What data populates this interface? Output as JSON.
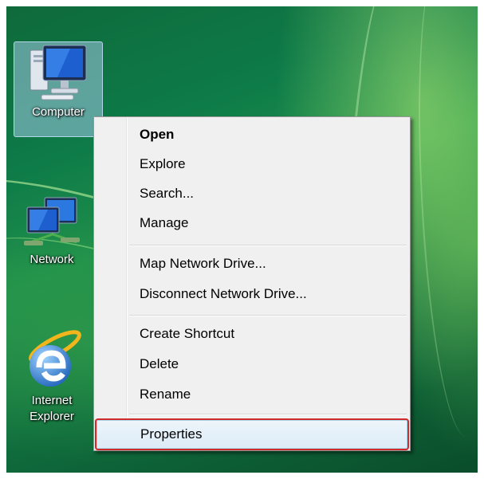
{
  "desktop": {
    "icons": [
      {
        "label": "Computer",
        "icon": "computer-icon",
        "selected": true
      },
      {
        "label": "Network",
        "icon": "network-icon",
        "selected": false
      },
      {
        "label_line1": "Internet",
        "label_line2": "Explorer",
        "icon": "internet-explorer-icon",
        "selected": false
      }
    ]
  },
  "context_menu": {
    "items": [
      {
        "label": "Open",
        "bold": true
      },
      {
        "label": "Explore"
      },
      {
        "label": "Search..."
      },
      {
        "label": "Manage"
      },
      {
        "label": "Map Network Drive..."
      },
      {
        "label": "Disconnect Network Drive..."
      },
      {
        "label": "Create Shortcut"
      },
      {
        "label": "Delete"
      },
      {
        "label": "Rename"
      },
      {
        "label": "Properties",
        "highlighted": true
      }
    ],
    "highlight_color": "#d22a2a"
  }
}
